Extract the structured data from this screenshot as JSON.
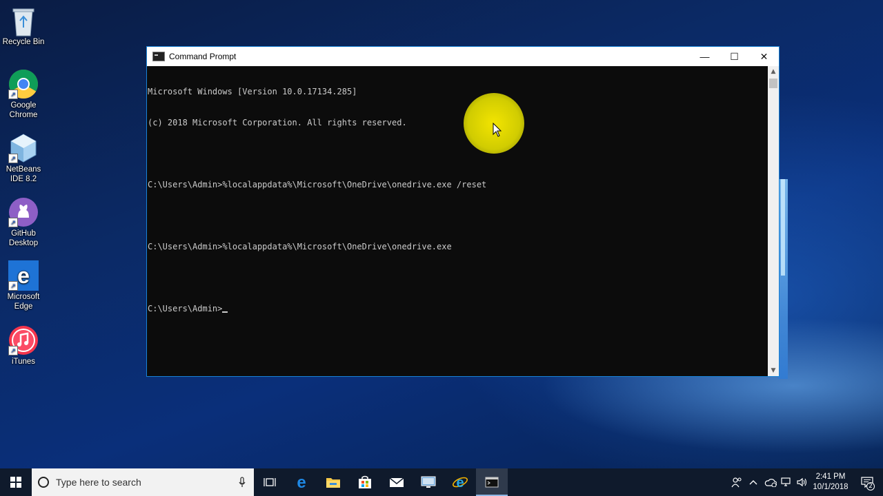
{
  "desktop": {
    "icons": [
      {
        "label": "Recycle Bin",
        "icon": "recycle-bin-icon"
      },
      {
        "label": "Google Chrome",
        "icon": "chrome-icon"
      },
      {
        "label": "NetBeans IDE 8.2",
        "icon": "netbeans-icon"
      },
      {
        "label": "GitHub Desktop",
        "icon": "github-icon"
      },
      {
        "label": "Microsoft Edge",
        "icon": "edge-icon"
      },
      {
        "label": "iTunes",
        "icon": "itunes-icon"
      }
    ]
  },
  "window": {
    "title": "Command Prompt",
    "lines": [
      "Microsoft Windows [Version 10.0.17134.285]",
      "(c) 2018 Microsoft Corporation. All rights reserved.",
      "",
      "C:\\Users\\Admin>%localappdata%\\Microsoft\\OneDrive\\onedrive.exe /reset",
      "",
      "C:\\Users\\Admin>%localappdata%\\Microsoft\\OneDrive\\onedrive.exe",
      "",
      "C:\\Users\\Admin>"
    ],
    "buttons": {
      "minimize": "—",
      "maximize": "☐",
      "close": "✕"
    }
  },
  "taskbar": {
    "search_placeholder": "Type here to search",
    "apps": [
      "task-view-icon",
      "edge-icon",
      "file-explorer-icon",
      "store-icon",
      "mail-icon",
      "remote-desktop-icon",
      "internet-explorer-icon",
      "command-prompt-icon"
    ],
    "clock": {
      "time": "2:41 PM",
      "date": "10/1/2018"
    },
    "notification_count": "2"
  }
}
